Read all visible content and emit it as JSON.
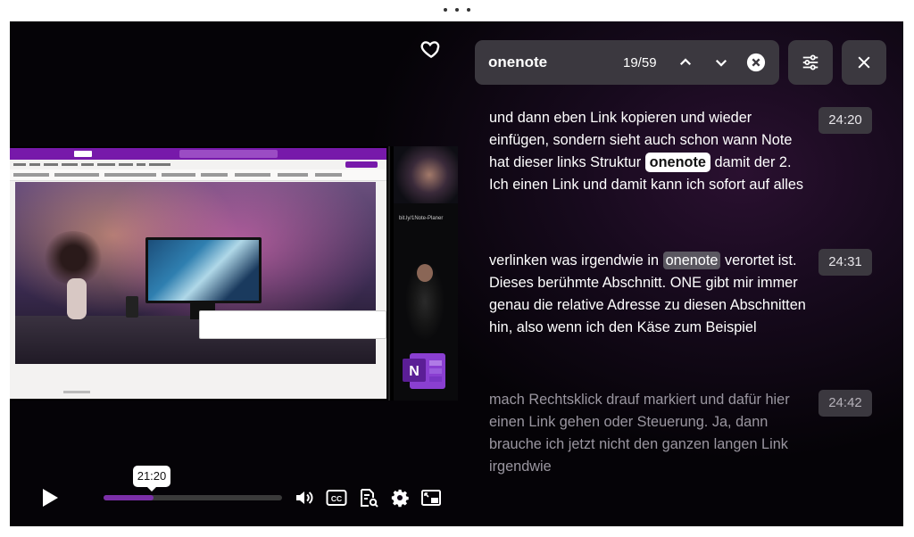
{
  "window": {
    "drag_handle": "drag-dots-icon"
  },
  "search": {
    "query": "onenote",
    "match_counter": "19/59",
    "icons": {
      "prev": "chevron-up-icon",
      "next": "chevron-down-icon",
      "clear": "clear-circle-icon",
      "filters": "sliders-icon",
      "close": "close-icon"
    }
  },
  "favorite": {
    "icon": "heart-icon"
  },
  "video_thumbnail": {
    "side_url": "bit.ly/1Note-Planer"
  },
  "transcript": {
    "segments": [
      {
        "timestamp": "24:20",
        "text_before": "und dann eben Link kopieren und wieder einfügen, sondern sieht auch schon wann Note hat dieser links Struktur ",
        "highlight": "onenote",
        "text_after": " damit der 2. Ich einen Link und damit kann ich sofort auf alles",
        "state": "active"
      },
      {
        "timestamp": "24:31",
        "text_before": "verlinken was irgendwie in ",
        "highlight": "onenote",
        "text_after": " verortet ist. Dieses berühmte Abschnitt. ONE gibt mir immer genau die relative Adresse zu diesen Abschnitten hin, also wenn ich den Käse zum Beispiel",
        "state": "match"
      },
      {
        "timestamp": "24:42",
        "text": "mach Rechtsklick drauf markiert und dafür hier einen Link gehen oder Steuerung. Ja, dann brauche ich jetzt nicht den ganzen langen Link irgendwie",
        "state": "dim"
      }
    ]
  },
  "controls": {
    "current_time_tooltip": "21:20",
    "progress_fraction": 0.28,
    "icons": {
      "play": "play-icon",
      "volume": "volume-icon",
      "captions": "cc-icon",
      "transcript_search": "transcript-search-icon",
      "settings": "gear-icon",
      "pip": "picture-in-picture-icon"
    }
  },
  "colors": {
    "accent": "#7b2fa8",
    "panel": "#3b383f",
    "highlight_active": "#ffffff",
    "highlight_other": "#5a5760"
  }
}
